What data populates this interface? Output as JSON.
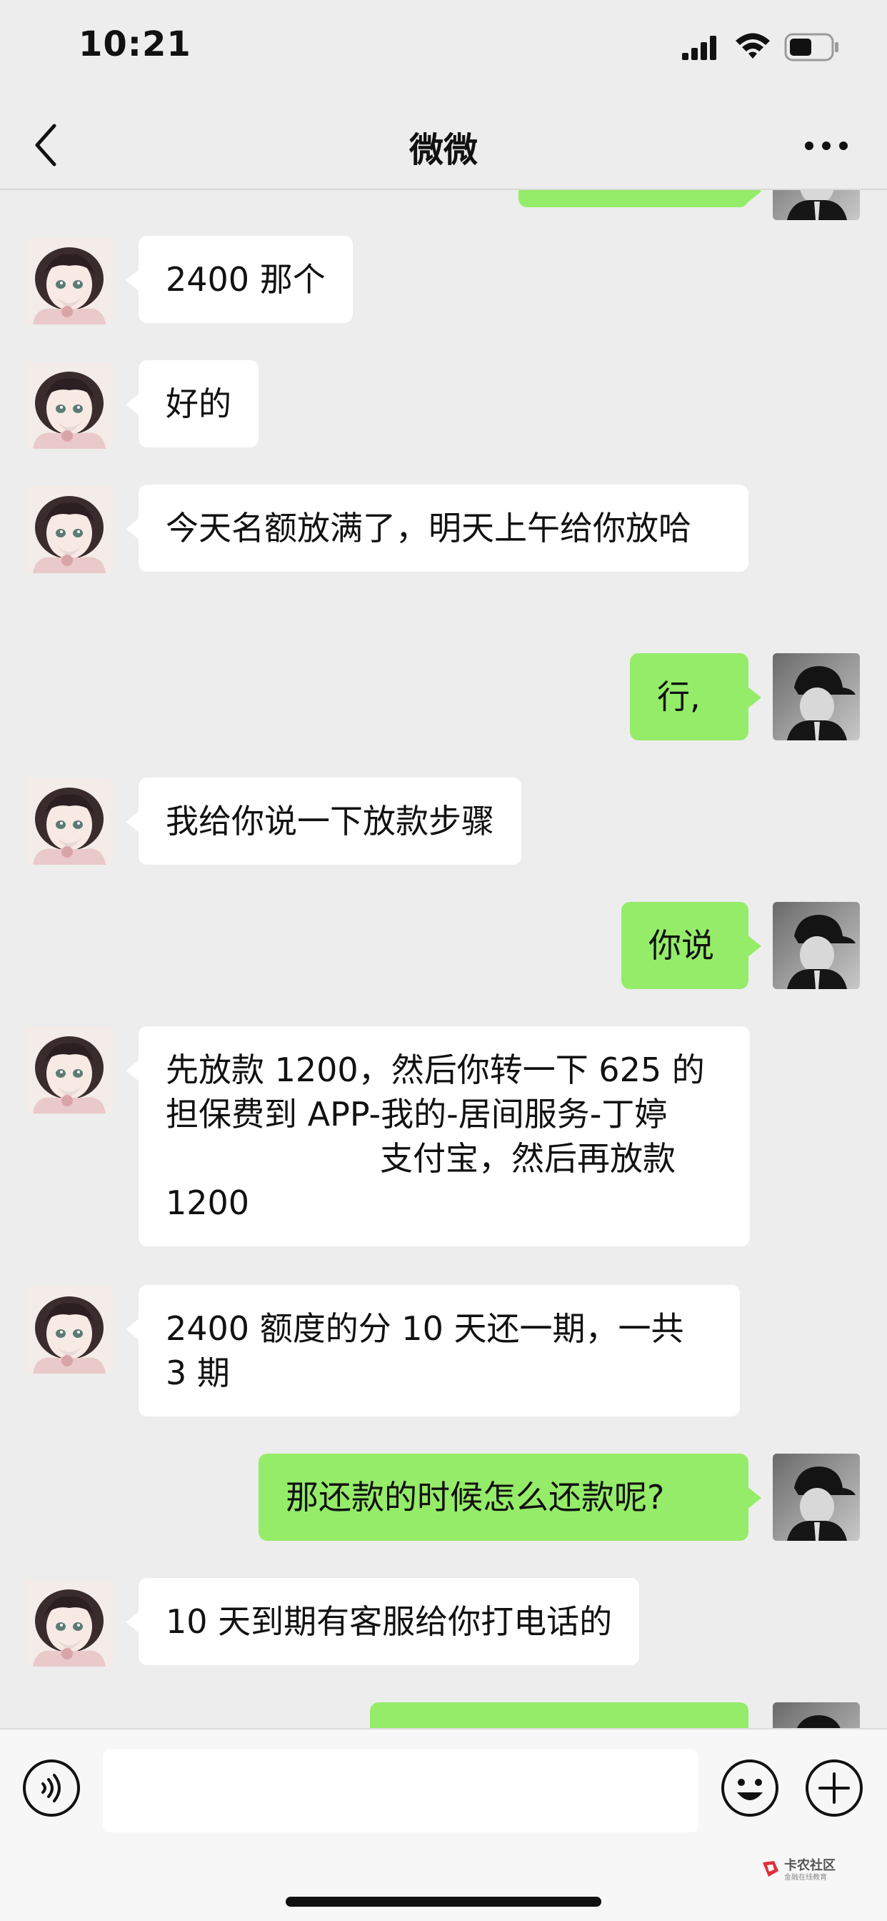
{
  "status_bar": {
    "time": "10:21"
  },
  "navbar": {
    "title": "微微"
  },
  "messages": [
    {
      "side": "left",
      "text": "2400 那个"
    },
    {
      "side": "left",
      "text": "好的"
    },
    {
      "side": "left",
      "text": "今天名额放满了，明天上午给你放哈"
    },
    {
      "side": "right",
      "text": "行,"
    },
    {
      "side": "left",
      "text": "我给你说一下放款步骤"
    },
    {
      "side": "right",
      "text": "你说"
    },
    {
      "side": "left",
      "text_a": "先放款 1200，然后你转一下 625 的担保费到 APP-我的-居间服务-丁婷",
      "text_b": "支付宝，然后再放款 1200"
    },
    {
      "side": "left",
      "text": "2400 额度的分 10 天还一期，一共 3 期"
    },
    {
      "side": "right",
      "text": "那还款的时候怎么还款呢?"
    },
    {
      "side": "left",
      "text": "10 天到期有客服给你打电话的"
    }
  ],
  "input": {
    "value": ""
  },
  "watermark": {
    "name": "卡农社区",
    "sub": "金融在线教育"
  },
  "colors": {
    "background": "#ededed",
    "bubble_left": "#ffffff",
    "bubble_right": "#95ec69"
  },
  "icons": [
    "signal-icon",
    "wifi-icon",
    "battery-icon",
    "back-icon",
    "more-icon",
    "voice-icon",
    "emoji-icon",
    "plus-icon"
  ]
}
